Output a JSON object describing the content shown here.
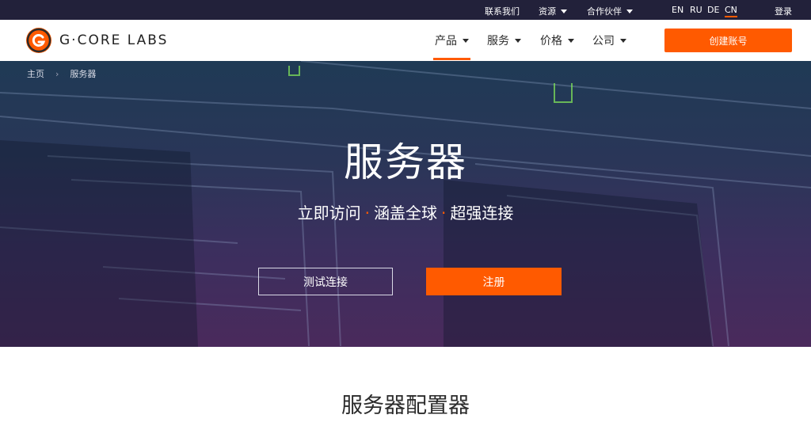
{
  "topbar": {
    "contact": "联系我们",
    "resources": "资源",
    "partners": "合作伙伴",
    "languages": [
      "EN",
      "RU",
      "DE",
      "CN"
    ],
    "active_language": "CN",
    "login": "登录"
  },
  "nav": {
    "logo_text": "G·CORE LABS",
    "items": [
      {
        "label": "产品"
      },
      {
        "label": "服务"
      },
      {
        "label": "价格"
      },
      {
        "label": "公司"
      }
    ],
    "create_account": "创建账号"
  },
  "breadcrumb": {
    "home": "主页",
    "current": "服务器"
  },
  "hero": {
    "title": "服务器",
    "subtitle_parts": [
      "立即访问",
      "涵盖全球",
      "超强连接"
    ],
    "separator": "·",
    "test_button": "测试连接",
    "register_button": "注册"
  },
  "section": {
    "title": "服务器配置器"
  },
  "colors": {
    "accent": "#ff5a00",
    "topbar": "#22213a"
  }
}
